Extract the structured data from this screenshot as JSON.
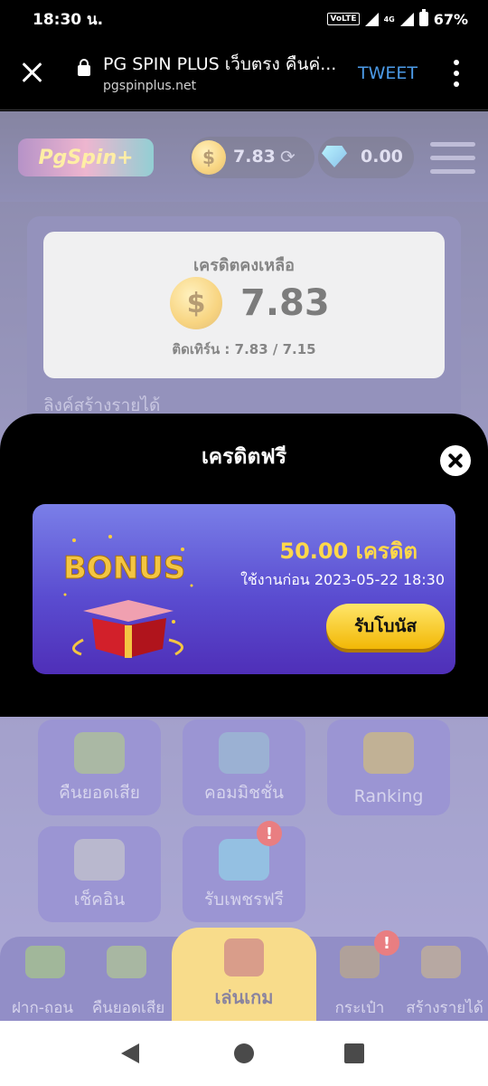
{
  "status_bar": {
    "time": "18:30 น.",
    "volte": "VoLTE",
    "network": "4G",
    "battery": "67%"
  },
  "browser": {
    "title": "PG SPIN PLUS เว็บตรง คืนค่...",
    "url": "pgspinplus.net",
    "action": "TWEET",
    "icons": [
      "close-icon",
      "lock-icon",
      "more-vert-icon"
    ]
  },
  "header": {
    "logo_text": "PgSpin+",
    "credit": "7.83",
    "diamonds": "0.00",
    "icons": [
      "coin-icon",
      "refresh-icon",
      "diamond-icon",
      "menu-icon"
    ]
  },
  "credit_panel": {
    "label": "เครดิตคงเหลือ",
    "value": "7.83",
    "turnover": "ติดเทิร์น : 7.83 / 7.15"
  },
  "link_label": "ลิงค์สร้างรายได้",
  "tiles": [
    {
      "label": "คืนยอดเสีย",
      "icon": "cashback-icon"
    },
    {
      "label": "คอมมิชชั่น",
      "icon": "commission-icon"
    },
    {
      "label": "Ranking",
      "icon": "trophy-icon"
    },
    {
      "label": "เช็คอิน",
      "icon": "calendar-clock-icon"
    },
    {
      "label": "รับเพชรฟรี",
      "icon": "diamond-icon",
      "badge": "!"
    }
  ],
  "bottom_nav": [
    {
      "label": "ฝาก-ถอน",
      "icon": "deposit-icon"
    },
    {
      "label": "คืนยอดเสีย",
      "icon": "cashback-icon"
    },
    {
      "label": "เล่นเกม",
      "icon": "slot-machine-icon",
      "active": true
    },
    {
      "label": "กระเป๋า",
      "icon": "wallet-icon",
      "badge": "!"
    },
    {
      "label": "สร้างรายได้",
      "icon": "group-icon"
    }
  ],
  "modal": {
    "title": "เครดิตฟรี",
    "bonus_art_text": "BONUS",
    "amount": "50.00 เครดิต",
    "expire": "ใช้งานก่อน 2023-05-22 18:30",
    "claim_button": "รับโบนัส"
  },
  "colors": {
    "accent": "#f2bf2c",
    "bonus_amount": "#ffd84a",
    "badge": "#d8141b",
    "link": "#4c9be8"
  }
}
